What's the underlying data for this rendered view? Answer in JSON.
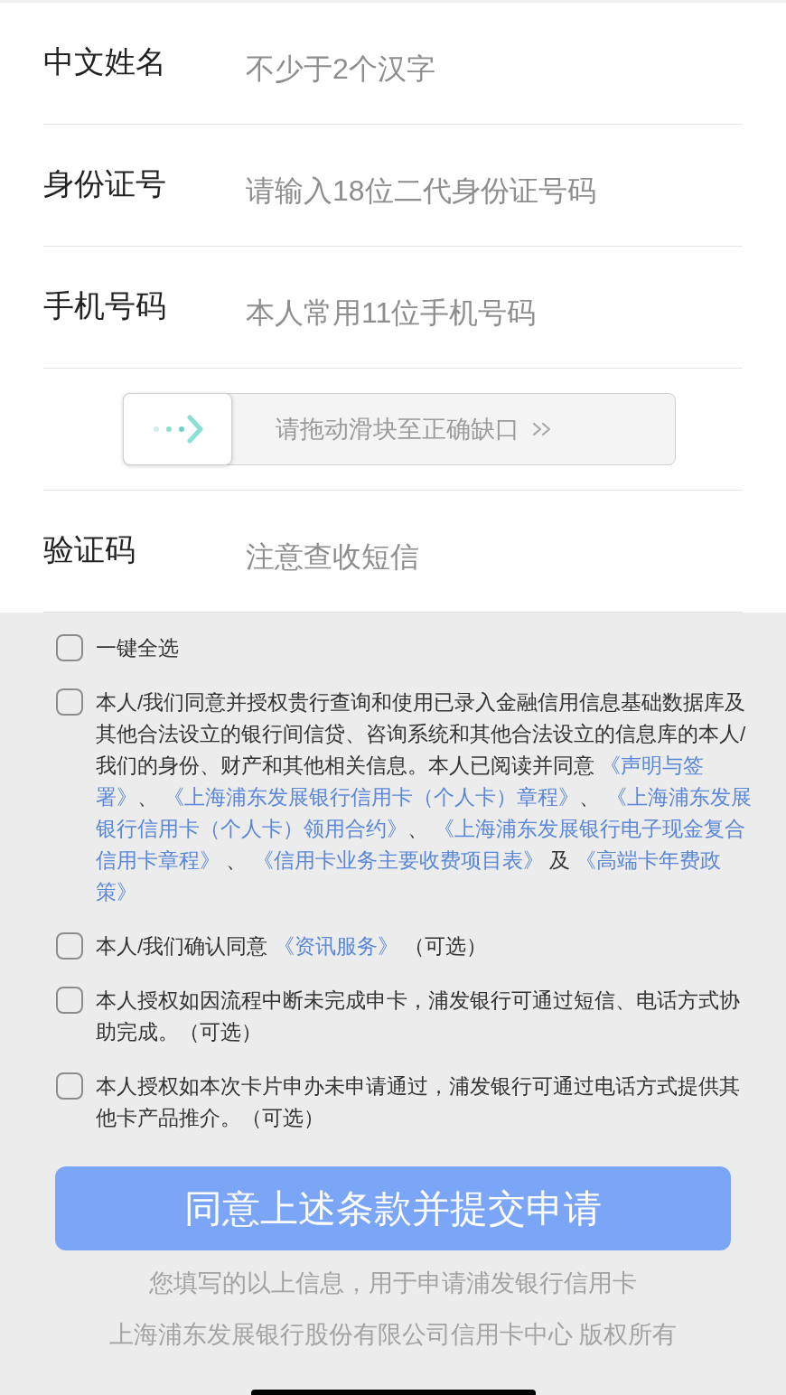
{
  "rows": [
    {
      "kind": "input",
      "label": "中文姓名",
      "placeholder": "不少于2个汉字"
    },
    {
      "kind": "input",
      "label": "身份证号",
      "placeholder": "请输入18位二代身份证号码"
    },
    {
      "kind": "input",
      "label": "手机号码",
      "placeholder": "本人常用11位手机号码"
    },
    {
      "kind": "slider",
      "hint": "请拖动滑块至正确缺口",
      "level": 0
    },
    {
      "kind": "input",
      "label": "验证码",
      "placeholder": "注意查收短信"
    }
  ],
  "consents": [
    {
      "checked": false,
      "lines": [
        [
          {
            "kind": "text",
            "text": "一键全选"
          }
        ]
      ]
    },
    {
      "checked": false,
      "lines": [
        [
          {
            "kind": "text",
            "text": "本人/我们同意并授权贵行查询和使用已录入金融信用信息基础数据库及"
          }
        ],
        [
          {
            "kind": "text",
            "text": "其他合法设立的银行间信贷、咨询系统和其他合法设立的信息库的本人/"
          }
        ],
        [
          {
            "kind": "text",
            "text": "我们的身份、财产和其他相关信息。本人已阅读并同意 "
          },
          {
            "kind": "link",
            "text": "《声明与签"
          }
        ],
        [
          {
            "kind": "link",
            "text": "署》"
          },
          {
            "kind": "text",
            "text": "、 "
          },
          {
            "kind": "link",
            "text": "《上海浦东发展银行信用卡（个人卡）章程》"
          },
          {
            "kind": "text",
            "text": "、 "
          },
          {
            "kind": "link",
            "text": "《上海浦东发展"
          }
        ],
        [
          {
            "kind": "link",
            "text": "银行信用卡（个人卡）领用合约》"
          },
          {
            "kind": "text",
            "text": "、 "
          },
          {
            "kind": "link",
            "text": "《上海浦东发展银行电子现金复合"
          }
        ],
        [
          {
            "kind": "link",
            "text": "信用卡章程》"
          },
          {
            "kind": "text",
            "text": " 、 "
          },
          {
            "kind": "link",
            "text": "《信用卡业务主要收费项目表》"
          },
          {
            "kind": "text",
            "text": " 及 "
          },
          {
            "kind": "link",
            "text": "《高端卡年费政"
          }
        ],
        [
          {
            "kind": "link",
            "text": "策》"
          }
        ]
      ]
    },
    {
      "checked": false,
      "lines": [
        [
          {
            "kind": "text",
            "text": "本人/我们确认同意 "
          },
          {
            "kind": "link",
            "text": "《资讯服务》"
          },
          {
            "kind": "text",
            "text": " （可选）"
          }
        ]
      ]
    },
    {
      "checked": false,
      "lines": [
        [
          {
            "kind": "text",
            "text": "本人授权如因流程中断未完成申卡，浦发银行可通过短信、电话方式协"
          }
        ],
        [
          {
            "kind": "text",
            "text": "助完成。（可选）"
          }
        ]
      ]
    },
    {
      "checked": false,
      "lines": [
        [
          {
            "kind": "text",
            "text": "本人授权如本次卡片申办未申请通过，浦发银行可通过电话方式提供其"
          }
        ],
        [
          {
            "kind": "text",
            "text": "他卡产品推介。（可选）"
          }
        ]
      ]
    }
  ],
  "submit_button": "同意上述条款并提交申请",
  "footer": [
    "您填写的以上信息，用于申请浦发银行信用卡",
    "上海浦东发展银行股份有限公司信用卡中心 版权所有"
  ]
}
